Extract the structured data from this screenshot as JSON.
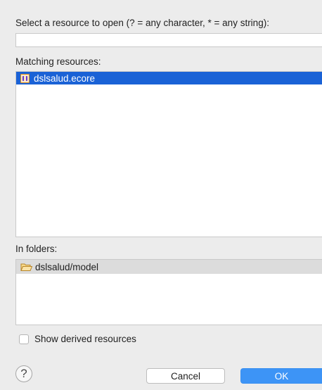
{
  "dialog": {
    "prompt_label": "Select a resource to open (? = any character, * = any string):",
    "search_value": "",
    "matching_label": "Matching resources:",
    "matching_items": [
      {
        "name": "dslsalud.ecore",
        "icon": "ecore-file-icon",
        "selected": true
      }
    ],
    "folders_label": "In folders:",
    "folder_items": [
      {
        "name": "dslsalud/model",
        "icon": "folder-icon",
        "selected": true
      }
    ],
    "show_derived_label": "Show derived resources",
    "show_derived_checked": false,
    "help_symbol": "?",
    "cancel_label": "Cancel",
    "ok_label": "OK"
  },
  "colors": {
    "selection": "#1a62d6",
    "ok_button": "#3d94f6",
    "background": "#ececec"
  }
}
